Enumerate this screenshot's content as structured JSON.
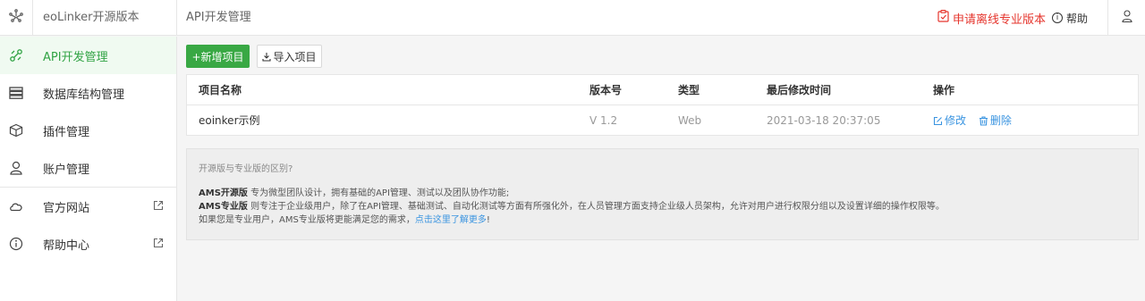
{
  "header": {
    "app_title": "eoLinker开源版本",
    "page_title": "API开发管理",
    "apply_label": "申请离线专业版本",
    "help_label": "帮助",
    "logo_icon": "eolinker-logo-icon",
    "user_icon": "user-icon"
  },
  "sidebar": {
    "items": [
      {
        "label": "API开发管理",
        "icon": "link-icon",
        "active": true
      },
      {
        "label": "数据库结构管理",
        "icon": "database-icon"
      },
      {
        "label": "插件管理",
        "icon": "cube-icon"
      },
      {
        "label": "账户管理",
        "icon": "user-icon"
      },
      {
        "label": "官方网站",
        "icon": "cloud-icon",
        "external": true
      },
      {
        "label": "帮助中心",
        "icon": "info-icon",
        "external": true
      }
    ]
  },
  "toolbar": {
    "add_label": "+新增项目",
    "import_label": "导入项目"
  },
  "table": {
    "headers": [
      "项目名称",
      "版本号",
      "类型",
      "最后修改时间",
      "操作"
    ],
    "rows": [
      {
        "name": "eoinker示例",
        "version": "V 1.2",
        "type": "Web",
        "modified": "2021-03-18 20:37:05",
        "edit_label": "修改",
        "delete_label": "删除"
      }
    ]
  },
  "info": {
    "question": "开源版与专业版的区别?",
    "ams_open_title": "AMS开源版",
    "ams_open_text": " 专为微型团队设计，拥有基础的API管理、测试以及团队协作功能;",
    "ams_pro_title": "AMS专业版",
    "ams_pro_text": " 则专注于企业级用户，除了在API管理、基础测试、自动化测试等方面有所强化外，在人员管理方面支持企业级人员架构，允许对用户进行权限分组以及设置详细的操作权限等。",
    "pro_user_text": "如果您是专业用户，AMS专业版将更能满足您的需求，",
    "learn_more_link": "点击这里了解更多",
    "tail": "!"
  },
  "colors": {
    "accent_green": "#39a844",
    "link_blue": "#3a94e0",
    "apply_red": "#e5352d"
  }
}
